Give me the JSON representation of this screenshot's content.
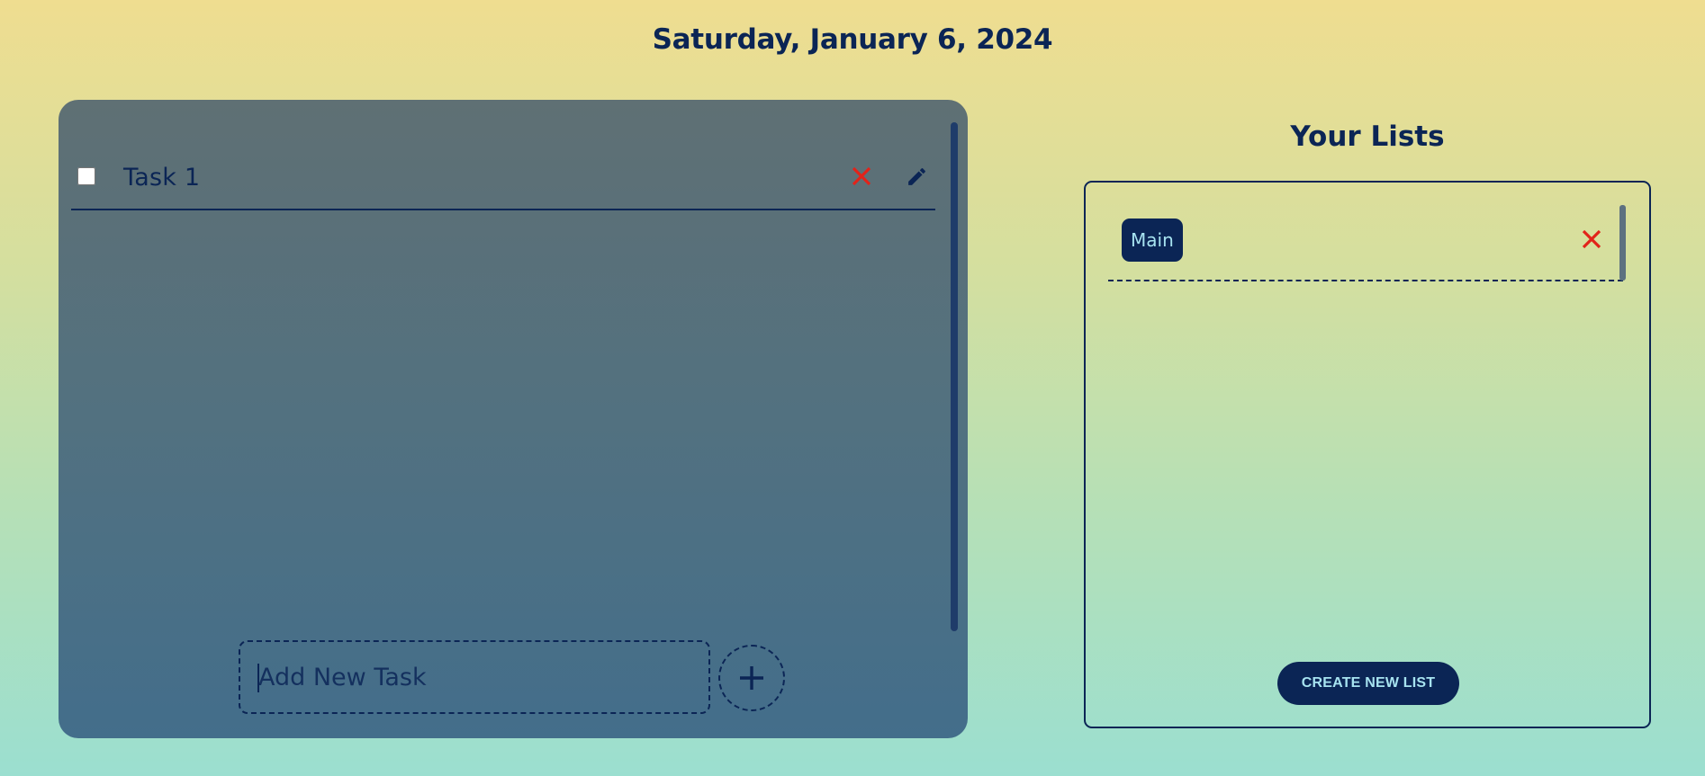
{
  "header": {
    "date": "Saturday, January 6, 2024"
  },
  "tasks": {
    "items": [
      {
        "label": "Task 1",
        "checked": false
      }
    ],
    "add_input": {
      "placeholder": "Add New Task",
      "value": ""
    },
    "icons": {
      "delete": "close-icon",
      "edit": "pencil-icon",
      "add": "plus-icon"
    }
  },
  "lists": {
    "heading": "Your Lists",
    "items": [
      {
        "label": "Main"
      }
    ],
    "create_label": "CREATE NEW LIST"
  },
  "colors": {
    "primary": "#0b2555",
    "accent_text": "#a7e3f0",
    "delete": "#e2231a",
    "panel_top": "#5f7074",
    "panel_bottom": "#436e8b"
  }
}
